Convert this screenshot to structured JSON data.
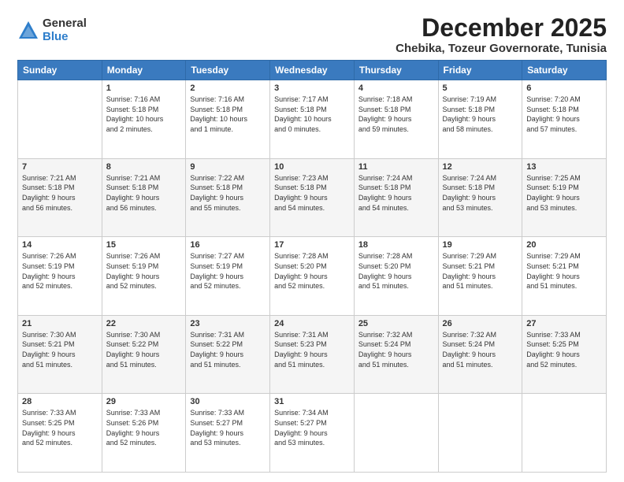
{
  "logo": {
    "general": "General",
    "blue": "Blue"
  },
  "title": "December 2025",
  "location": "Chebika, Tozeur Governorate, Tunisia",
  "days_header": [
    "Sunday",
    "Monday",
    "Tuesday",
    "Wednesday",
    "Thursday",
    "Friday",
    "Saturday"
  ],
  "weeks": [
    [
      {
        "day": "",
        "info": ""
      },
      {
        "day": "1",
        "info": "Sunrise: 7:16 AM\nSunset: 5:18 PM\nDaylight: 10 hours\nand 2 minutes."
      },
      {
        "day": "2",
        "info": "Sunrise: 7:16 AM\nSunset: 5:18 PM\nDaylight: 10 hours\nand 1 minute."
      },
      {
        "day": "3",
        "info": "Sunrise: 7:17 AM\nSunset: 5:18 PM\nDaylight: 10 hours\nand 0 minutes."
      },
      {
        "day": "4",
        "info": "Sunrise: 7:18 AM\nSunset: 5:18 PM\nDaylight: 9 hours\nand 59 minutes."
      },
      {
        "day": "5",
        "info": "Sunrise: 7:19 AM\nSunset: 5:18 PM\nDaylight: 9 hours\nand 58 minutes."
      },
      {
        "day": "6",
        "info": "Sunrise: 7:20 AM\nSunset: 5:18 PM\nDaylight: 9 hours\nand 57 minutes."
      }
    ],
    [
      {
        "day": "7",
        "info": "Sunrise: 7:21 AM\nSunset: 5:18 PM\nDaylight: 9 hours\nand 56 minutes."
      },
      {
        "day": "8",
        "info": "Sunrise: 7:21 AM\nSunset: 5:18 PM\nDaylight: 9 hours\nand 56 minutes."
      },
      {
        "day": "9",
        "info": "Sunrise: 7:22 AM\nSunset: 5:18 PM\nDaylight: 9 hours\nand 55 minutes."
      },
      {
        "day": "10",
        "info": "Sunrise: 7:23 AM\nSunset: 5:18 PM\nDaylight: 9 hours\nand 54 minutes."
      },
      {
        "day": "11",
        "info": "Sunrise: 7:24 AM\nSunset: 5:18 PM\nDaylight: 9 hours\nand 54 minutes."
      },
      {
        "day": "12",
        "info": "Sunrise: 7:24 AM\nSunset: 5:18 PM\nDaylight: 9 hours\nand 53 minutes."
      },
      {
        "day": "13",
        "info": "Sunrise: 7:25 AM\nSunset: 5:19 PM\nDaylight: 9 hours\nand 53 minutes."
      }
    ],
    [
      {
        "day": "14",
        "info": "Sunrise: 7:26 AM\nSunset: 5:19 PM\nDaylight: 9 hours\nand 52 minutes."
      },
      {
        "day": "15",
        "info": "Sunrise: 7:26 AM\nSunset: 5:19 PM\nDaylight: 9 hours\nand 52 minutes."
      },
      {
        "day": "16",
        "info": "Sunrise: 7:27 AM\nSunset: 5:19 PM\nDaylight: 9 hours\nand 52 minutes."
      },
      {
        "day": "17",
        "info": "Sunrise: 7:28 AM\nSunset: 5:20 PM\nDaylight: 9 hours\nand 52 minutes."
      },
      {
        "day": "18",
        "info": "Sunrise: 7:28 AM\nSunset: 5:20 PM\nDaylight: 9 hours\nand 51 minutes."
      },
      {
        "day": "19",
        "info": "Sunrise: 7:29 AM\nSunset: 5:21 PM\nDaylight: 9 hours\nand 51 minutes."
      },
      {
        "day": "20",
        "info": "Sunrise: 7:29 AM\nSunset: 5:21 PM\nDaylight: 9 hours\nand 51 minutes."
      }
    ],
    [
      {
        "day": "21",
        "info": "Sunrise: 7:30 AM\nSunset: 5:21 PM\nDaylight: 9 hours\nand 51 minutes."
      },
      {
        "day": "22",
        "info": "Sunrise: 7:30 AM\nSunset: 5:22 PM\nDaylight: 9 hours\nand 51 minutes."
      },
      {
        "day": "23",
        "info": "Sunrise: 7:31 AM\nSunset: 5:22 PM\nDaylight: 9 hours\nand 51 minutes."
      },
      {
        "day": "24",
        "info": "Sunrise: 7:31 AM\nSunset: 5:23 PM\nDaylight: 9 hours\nand 51 minutes."
      },
      {
        "day": "25",
        "info": "Sunrise: 7:32 AM\nSunset: 5:24 PM\nDaylight: 9 hours\nand 51 minutes."
      },
      {
        "day": "26",
        "info": "Sunrise: 7:32 AM\nSunset: 5:24 PM\nDaylight: 9 hours\nand 51 minutes."
      },
      {
        "day": "27",
        "info": "Sunrise: 7:33 AM\nSunset: 5:25 PM\nDaylight: 9 hours\nand 52 minutes."
      }
    ],
    [
      {
        "day": "28",
        "info": "Sunrise: 7:33 AM\nSunset: 5:25 PM\nDaylight: 9 hours\nand 52 minutes."
      },
      {
        "day": "29",
        "info": "Sunrise: 7:33 AM\nSunset: 5:26 PM\nDaylight: 9 hours\nand 52 minutes."
      },
      {
        "day": "30",
        "info": "Sunrise: 7:33 AM\nSunset: 5:27 PM\nDaylight: 9 hours\nand 53 minutes."
      },
      {
        "day": "31",
        "info": "Sunrise: 7:34 AM\nSunset: 5:27 PM\nDaylight: 9 hours\nand 53 minutes."
      },
      {
        "day": "",
        "info": ""
      },
      {
        "day": "",
        "info": ""
      },
      {
        "day": "",
        "info": ""
      }
    ]
  ]
}
